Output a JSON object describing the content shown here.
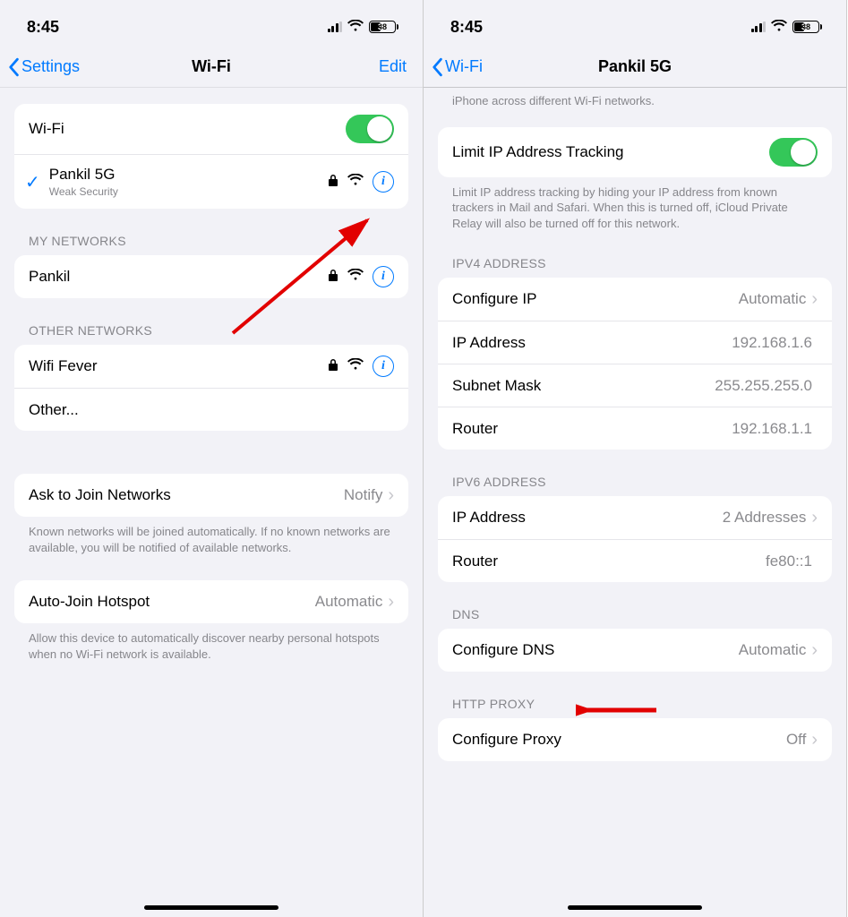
{
  "left": {
    "status": {
      "time": "8:45",
      "battery": "38"
    },
    "nav": {
      "back": "Settings",
      "title": "Wi-Fi",
      "edit": "Edit"
    },
    "wifi_toggle_label": "Wi-Fi",
    "connected": {
      "name": "Pankil 5G",
      "sub": "Weak Security"
    },
    "section_my": "My Networks",
    "my_networks": [
      {
        "name": "Pankil"
      }
    ],
    "section_other": "Other Networks",
    "other_networks": [
      {
        "name": "Wifi Fever"
      }
    ],
    "other_row": "Other...",
    "ask_join": {
      "label": "Ask to Join Networks",
      "value": "Notify"
    },
    "ask_join_footer": "Known networks will be joined automatically. If no known networks are available, you will be notified of available networks.",
    "auto_hotspot": {
      "label": "Auto-Join Hotspot",
      "value": "Automatic"
    },
    "auto_hotspot_footer": "Allow this device to automatically discover nearby personal hotspots when no Wi-Fi network is available."
  },
  "right": {
    "status": {
      "time": "8:45",
      "battery": "38"
    },
    "nav": {
      "back": "Wi-Fi",
      "title": "Pankil 5G"
    },
    "top_footer": "iPhone across different Wi-Fi networks.",
    "limit_tracking": "Limit IP Address Tracking",
    "limit_footer": "Limit IP address tracking by hiding your IP address from known trackers in Mail and Safari. When this is turned off, iCloud Private Relay will also be turned off for this network.",
    "ipv4_header": "IPV4 Address",
    "ipv4": {
      "configure": {
        "label": "Configure IP",
        "value": "Automatic"
      },
      "ip": {
        "label": "IP Address",
        "value": "192.168.1.6"
      },
      "mask": {
        "label": "Subnet Mask",
        "value": "255.255.255.0"
      },
      "router": {
        "label": "Router",
        "value": "192.168.1.1"
      }
    },
    "ipv6_header": "IPV6 Address",
    "ipv6": {
      "ip": {
        "label": "IP Address",
        "value": "2 Addresses"
      },
      "router": {
        "label": "Router",
        "value": "fe80::1"
      }
    },
    "dns_header": "DNS",
    "dns": {
      "label": "Configure DNS",
      "value": "Automatic"
    },
    "proxy_header": "HTTP Proxy",
    "proxy": {
      "label": "Configure Proxy",
      "value": "Off"
    }
  }
}
